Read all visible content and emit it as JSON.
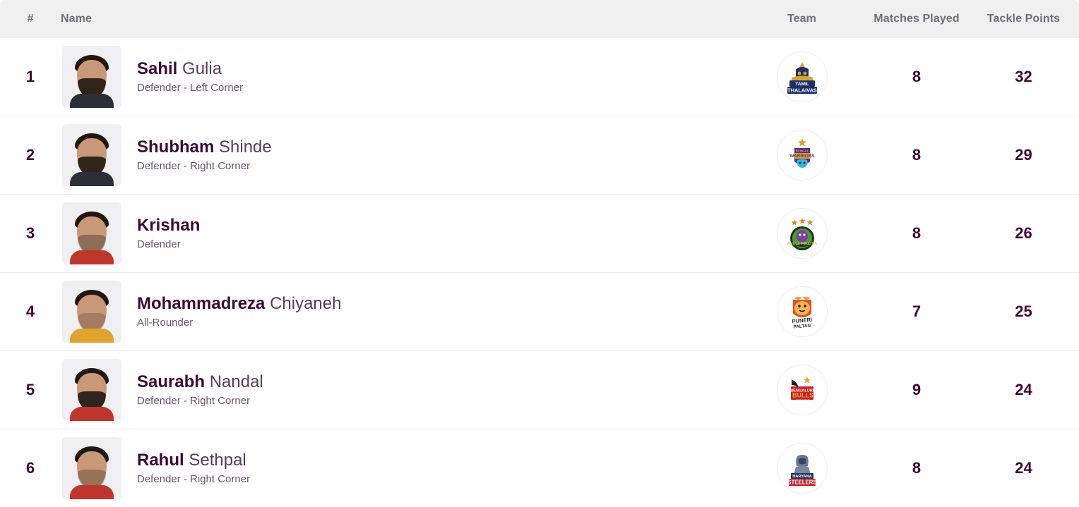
{
  "table": {
    "columns": {
      "rank": "#",
      "name": "Name",
      "team": "Team",
      "matches_played": "Matches Played",
      "tackle_points": "Tackle Points"
    },
    "rows": [
      {
        "rank": "1",
        "first_name": "Sahil",
        "last_name": "Gulia",
        "role": "Defender - Left Corner",
        "team": "Tamil Thalaivas",
        "team_icon": "tamil-thalaivas-logo",
        "matches_played": "8",
        "tackle_points": "32"
      },
      {
        "rank": "2",
        "first_name": "Shubham",
        "last_name": "Shinde",
        "role": "Defender - Right Corner",
        "team": "Bengal Warriors",
        "team_icon": "bengal-warriors-logo",
        "matches_played": "8",
        "tackle_points": "29"
      },
      {
        "rank": "3",
        "first_name": "Krishan",
        "last_name": "",
        "role": "Defender",
        "team": "Patna Pirates",
        "team_icon": "patna-pirates-logo",
        "matches_played": "8",
        "tackle_points": "26"
      },
      {
        "rank": "4",
        "first_name": "Mohammadreza",
        "last_name": "Chiyaneh",
        "role": "All-Rounder",
        "team": "Puneri Paltan",
        "team_icon": "puneri-paltan-logo",
        "matches_played": "7",
        "tackle_points": "25"
      },
      {
        "rank": "5",
        "first_name": "Saurabh",
        "last_name": "Nandal",
        "role": "Defender - Right Corner",
        "team": "Bengaluru Bulls",
        "team_icon": "bengaluru-bulls-logo",
        "matches_played": "9",
        "tackle_points": "24"
      },
      {
        "rank": "6",
        "first_name": "Rahul",
        "last_name": "Sethpal",
        "role": "Defender - Right Corner",
        "team": "Haryana Steelers",
        "team_icon": "haryana-steelers-logo",
        "matches_played": "8",
        "tackle_points": "24"
      }
    ]
  },
  "colors": {
    "header_bg": "#f0f0f0",
    "header_text": "#6f6f78",
    "value_text": "#3d0a35",
    "first_name_text": "#3a0b34",
    "last_name_text": "#5a3b5d",
    "role_text": "#6b5470",
    "row_divider": "#ededf0"
  }
}
